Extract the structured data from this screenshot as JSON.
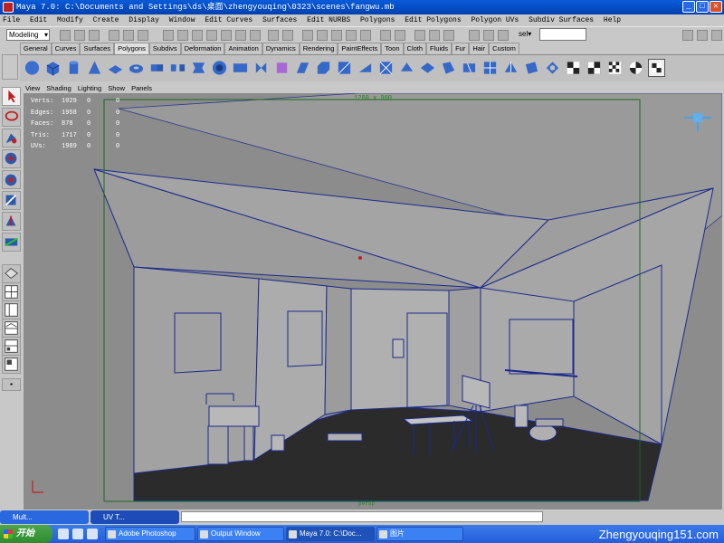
{
  "window": {
    "title": "Maya 7.0: C:\\Documents and Settings\\ds\\桌面\\zhengyouqing\\0323\\scenes\\fangwu.mb",
    "min": "_",
    "max": "□",
    "close": "✕"
  },
  "menubar": [
    "File",
    "Edit",
    "Modify",
    "Create",
    "Display",
    "Window",
    "Edit Curves",
    "Surfaces",
    "Edit NURBS",
    "Polygons",
    "Edit Polygons",
    "Polygon UVs",
    "Subdiv Surfaces",
    "Help"
  ],
  "statusline": {
    "mode": "Modeling",
    "sel_label": "sel▾"
  },
  "shelf_tabs": [
    "General",
    "Curves",
    "Surfaces",
    "Polygons",
    "Subdivs",
    "Deformation",
    "Animation",
    "Dynamics",
    "Rendering",
    "PaintEffects",
    "Toon",
    "Cloth",
    "Fluids",
    "Fur",
    "Hair",
    "Custom"
  ],
  "active_shelf_tab": "Polygons",
  "viewport": {
    "menu": [
      "View",
      "Shading",
      "Lighting",
      "Show",
      "Panels"
    ],
    "resolution": "1280 x 960",
    "hud": [
      {
        "label": "Verts:",
        "v1": "1029",
        "v2": "0",
        "v3": "0"
      },
      {
        "label": "Edges:",
        "v1": "1958",
        "v2": "0",
        "v3": "0"
      },
      {
        "label": "Faces:",
        "v1": "878",
        "v2": "0",
        "v3": "0"
      },
      {
        "label": "Tris:",
        "v1": "1717",
        "v2": "0",
        "v3": "0"
      },
      {
        "label": "UVs:",
        "v1": "1989",
        "v2": "0",
        "v3": "0"
      }
    ],
    "bottom_label": "persp"
  },
  "maya_tasks": [
    {
      "label": "Mult..."
    },
    {
      "label": "UV T..."
    }
  ],
  "taskbar": {
    "start": "开始",
    "tasks": [
      {
        "label": "Adobe Photoshop"
      },
      {
        "label": "Output Window"
      },
      {
        "label": "Maya 7.0: C:\\Doc..."
      },
      {
        "label": "图片"
      }
    ]
  },
  "watermark": "Zhengyouqing151.com",
  "colors": {
    "title_bar": "#0a5bd8",
    "viewport_bg": "#8c8c8c",
    "wireframe": "#1a2a8c",
    "taskbar": "#245edb",
    "start": "#2e8b2e"
  }
}
